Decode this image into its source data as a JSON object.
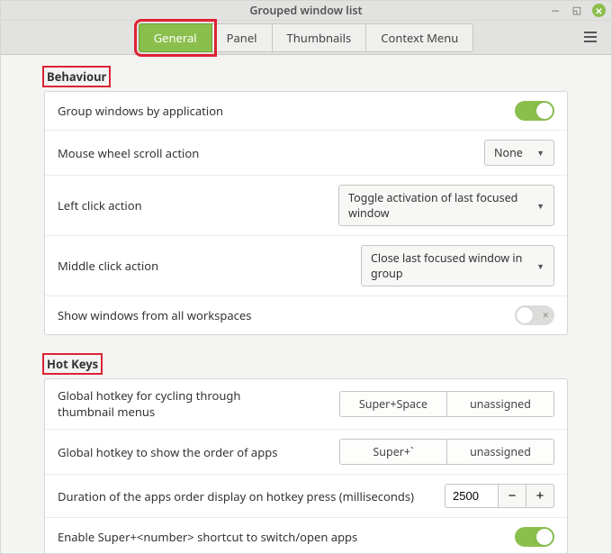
{
  "window": {
    "title": "Grouped window list"
  },
  "tabs": {
    "general": "General",
    "panel": "Panel",
    "thumbnails": "Thumbnails",
    "context_menu": "Context Menu"
  },
  "sections": {
    "behaviour": {
      "heading": "Behaviour",
      "rows": {
        "group_by_app": {
          "label": "Group windows by application",
          "value": true
        },
        "scroll_action": {
          "label": "Mouse wheel scroll action",
          "value": "None"
        },
        "left_click": {
          "label": "Left click action",
          "value": "Toggle activation of last focused window"
        },
        "middle_click": {
          "label": "Middle click action",
          "value": "Close last focused window in group"
        },
        "all_workspaces": {
          "label": "Show windows from all workspaces",
          "value": false
        }
      }
    },
    "hotkeys": {
      "heading": "Hot Keys",
      "rows": {
        "cycle_thumbs": {
          "label": "Global hotkey for cycling through thumbnail menus",
          "binding1": "Super+Space",
          "binding2": "unassigned"
        },
        "show_order": {
          "label": "Global hotkey to show the order of apps",
          "binding1": "Super+`",
          "binding2": "unassigned"
        },
        "duration": {
          "label": "Duration of the apps order display on hotkey press (milliseconds)",
          "value": "2500"
        },
        "super_number": {
          "label": "Enable Super+<number> shortcut to switch/open apps",
          "value": true
        }
      }
    }
  }
}
